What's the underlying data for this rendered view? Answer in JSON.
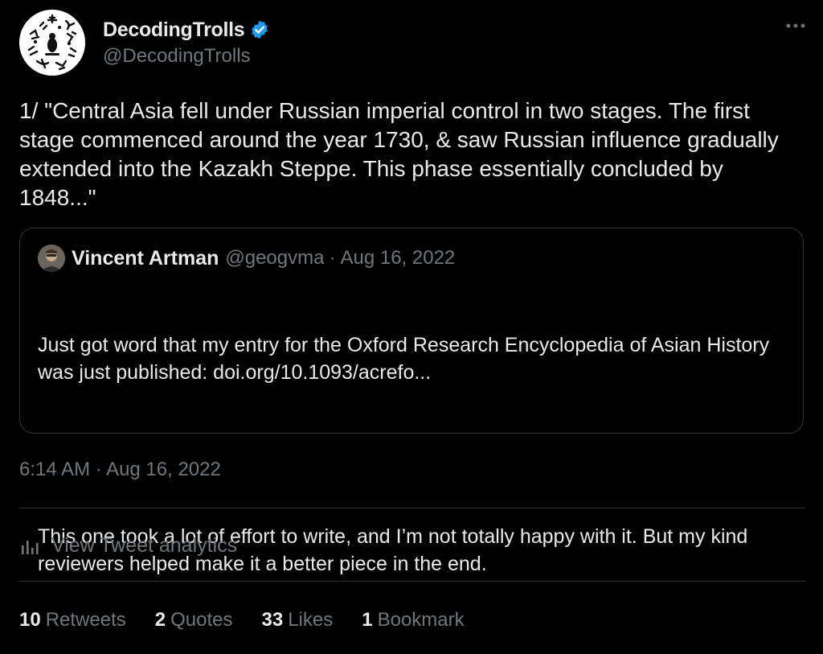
{
  "author": {
    "display_name": "DecodingTrolls",
    "handle": "@DecodingTrolls",
    "verified": true,
    "verified_color": "#1d9bf0"
  },
  "more_icon": "ellipsis-icon",
  "tweet": {
    "text": "1/ \"Central Asia fell under Russian imperial control in two stages. The first stage commenced around the year 1730, & saw Russian influence gradually extended into the Kazakh Steppe. This phase essentially concluded by 1848...\""
  },
  "quoted_tweet": {
    "display_name": "Vincent Artman",
    "handle": "@geogvma",
    "separator": "·",
    "date": "Aug 16, 2022",
    "paragraph_1": "Just got word that my entry for the Oxford Research Encyclopedia of Asian History was just published: doi.org/10.1093/acrefo...",
    "paragraph_2": "This one took a lot of effort to write, and I’m not totally happy with it. But my kind reviewers helped make it a better piece in the end."
  },
  "timestamp": "6:14 AM · Aug 16, 2022",
  "analytics": {
    "label": "View Tweet analytics",
    "icon": "analytics-bars-icon"
  },
  "stats": {
    "retweets": {
      "count": "10",
      "label": "Retweets"
    },
    "quotes": {
      "count": "2",
      "label": "Quotes"
    },
    "likes": {
      "count": "33",
      "label": "Likes"
    },
    "bookmarks": {
      "count": "1",
      "label": "Bookmark"
    }
  },
  "colors": {
    "background": "#000000",
    "primary_text": "#e7e9ea",
    "secondary_text": "#71767b",
    "border": "#2f3336"
  }
}
